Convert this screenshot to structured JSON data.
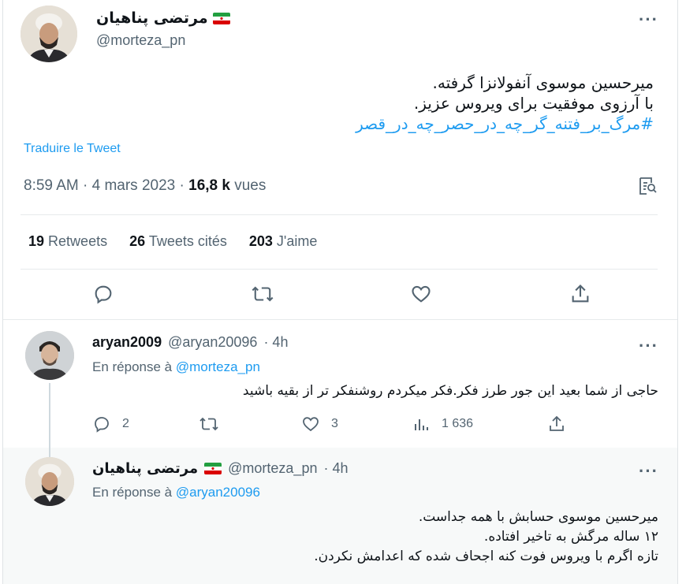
{
  "main_tweet": {
    "display_name": "مرتضی پناهیان",
    "handle": "@morteza_pn",
    "text_lines": [
      "میرحسین موسوی آنفولانزا گرفته.",
      "با آرزوی موفقیت برای ویروس عزیز."
    ],
    "hashtag": "#مرگ_بر_فتنه_گر_چه_در_حصر_چه_در_قصر",
    "translate_label": "Traduire le Tweet",
    "time": "8:59 AM",
    "separator": "·",
    "date": "4 mars 2023",
    "views_count": "16,8 k",
    "views_label": "vues",
    "retweets_count": "19",
    "retweets_label": "Retweets",
    "quotes_count": "26",
    "quotes_label": "Tweets cités",
    "likes_count": "203",
    "likes_label": "J'aime"
  },
  "reply_1": {
    "display_name": "aryan2009",
    "handle": "@aryan20096",
    "time": "· 4h",
    "in_reply_label": "En réponse à",
    "in_reply_handle": "@morteza_pn",
    "text": "حاجی از شما بعید این جور طرز فکر.فکر میکردم روشنفکر تر از بقیه باشید",
    "reply_count": "2",
    "like_count": "3",
    "views_count": "1 636"
  },
  "reply_2": {
    "display_name": "مرتضی پناهیان",
    "handle": "@morteza_pn",
    "time": "· 4h",
    "in_reply_label": "En réponse à",
    "in_reply_handle": "@aryan20096",
    "text_lines": [
      "میرحسین موسوی حسابش با همه جداست.",
      "۱۲ ساله مرگش به تاخیر افتاده.",
      "تازه اگرم با ویروس فوت کنه اجحاف شده که اعدامش نکردن."
    ]
  },
  "more_label": "···",
  "colors": {
    "accent": "#1d9bf0",
    "muted": "#536471",
    "text": "#0f1419"
  }
}
